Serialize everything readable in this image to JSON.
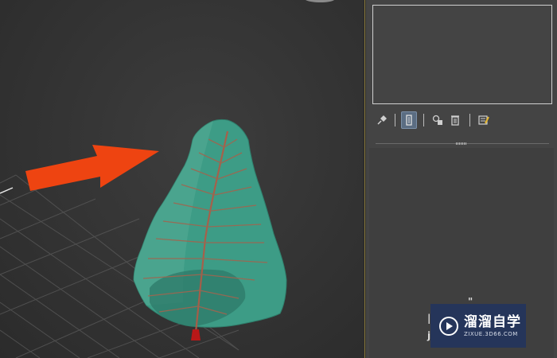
{
  "viewport": {
    "object": "leaf-model",
    "annotation": "arrow"
  },
  "command_panel": {
    "toolbar": [
      {
        "icon": "pin-stack-icon",
        "active": false
      },
      {
        "icon": "show-end-result-icon",
        "active": true
      },
      {
        "icon": "make-unique-icon",
        "active": false
      },
      {
        "icon": "remove-modifier-icon",
        "active": false
      },
      {
        "icon": "configure-modifier-sets-icon",
        "active": false
      }
    ]
  },
  "watermark": {
    "title": "溜溜自学",
    "url": "ZIXUE.3D66.COM"
  },
  "colors": {
    "viewport_bg": "#333333",
    "panel_bg": "#444444",
    "leaf_fill": "#3c9a84",
    "vein": "#a0654f",
    "arrow": "#ee4411",
    "watermark_bg": "#22345e"
  }
}
